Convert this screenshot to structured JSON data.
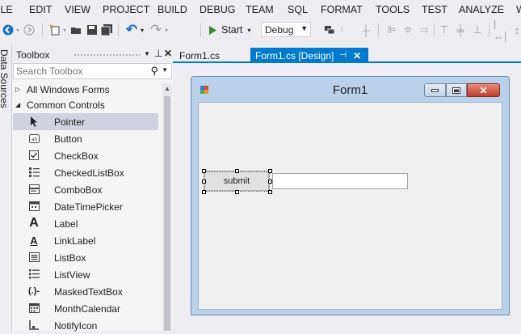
{
  "menu": [
    "ILE",
    "EDIT",
    "VIEW",
    "PROJECT",
    "BUILD",
    "DEBUG",
    "TEAM",
    "SQL",
    "FORMAT",
    "TOOLS",
    "TEST",
    "ANALYZE",
    "W"
  ],
  "toolbar": {
    "start_label": "Start",
    "start_icon": "play-icon",
    "config_value": "Debug"
  },
  "side_panel": {
    "label": "Data Sources"
  },
  "toolbox": {
    "title": "Toolbox",
    "search_placeholder": "Search Toolbox",
    "categories": [
      {
        "label": "All Windows Forms",
        "expanded": false
      },
      {
        "label": "Common Controls",
        "expanded": true
      }
    ],
    "items": [
      {
        "label": "Pointer",
        "icon": "pointer-icon",
        "selected": true
      },
      {
        "label": "Button",
        "icon": "button-icon"
      },
      {
        "label": "CheckBox",
        "icon": "checkbox-icon"
      },
      {
        "label": "CheckedListBox",
        "icon": "checkedlistbox-icon"
      },
      {
        "label": "ComboBox",
        "icon": "combobox-icon"
      },
      {
        "label": "DateTimePicker",
        "icon": "datetimepicker-icon"
      },
      {
        "label": "Label",
        "icon": "label-icon"
      },
      {
        "label": "LinkLabel",
        "icon": "linklabel-icon"
      },
      {
        "label": "ListBox",
        "icon": "listbox-icon"
      },
      {
        "label": "ListView",
        "icon": "listview-icon"
      },
      {
        "label": "MaskedTextBox",
        "icon": "maskedtextbox-icon"
      },
      {
        "label": "MonthCalendar",
        "icon": "monthcalendar-icon"
      },
      {
        "label": "NotifyIcon",
        "icon": "notifyicon-icon"
      }
    ]
  },
  "tabs": [
    {
      "label": "Form1.cs",
      "active": false
    },
    {
      "label": "Form1.cs [Design]",
      "active": true
    }
  ],
  "form": {
    "title": "Form1",
    "button_label": "submit",
    "textbox_value": ""
  },
  "colors": {
    "accent": "#007acc",
    "selection": "#cfd2df",
    "close_button": "#c7432f"
  }
}
